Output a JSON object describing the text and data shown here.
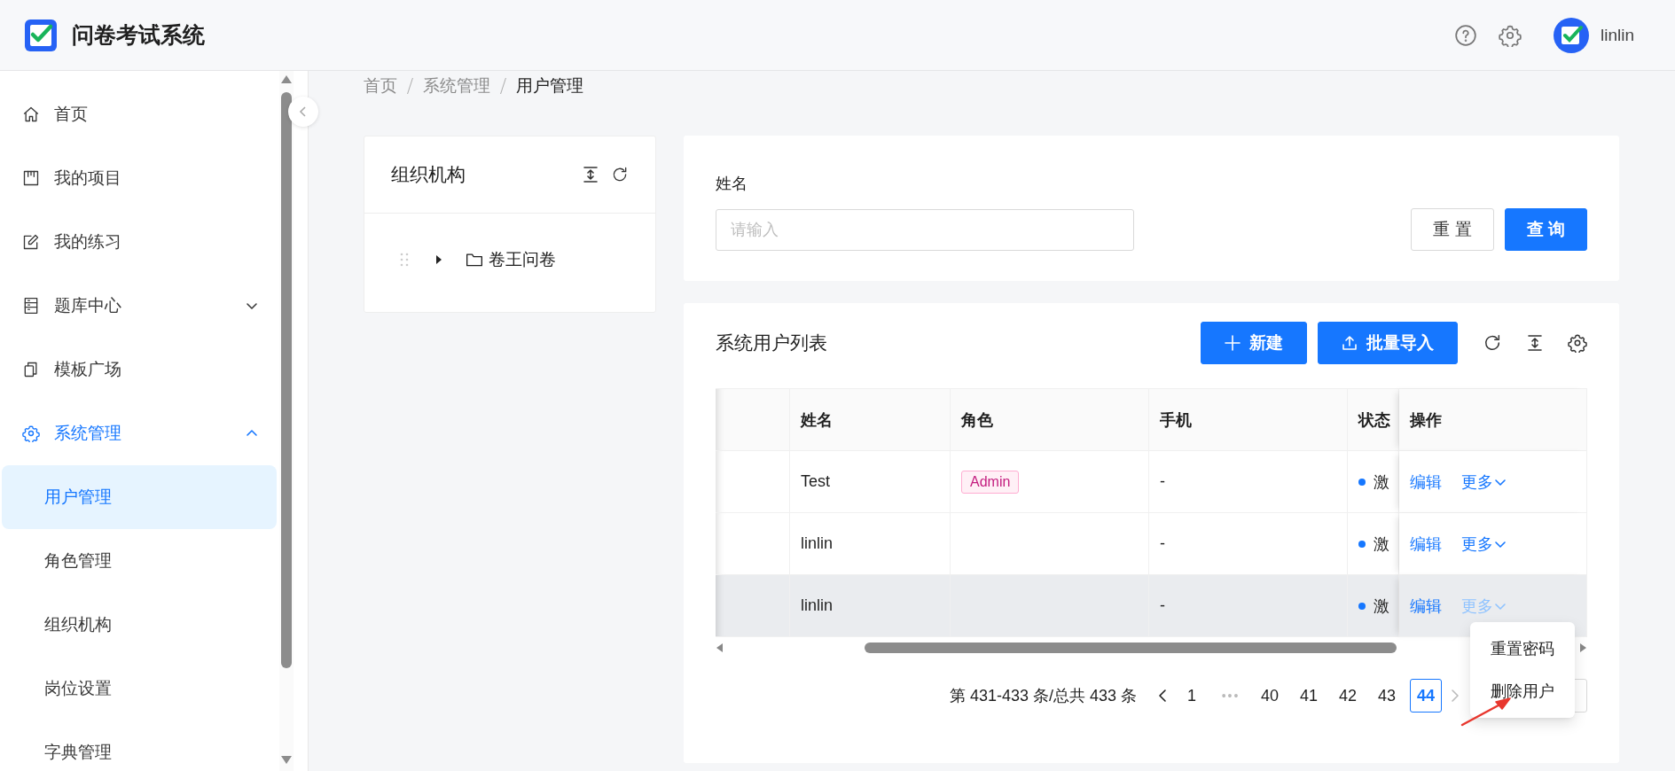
{
  "header": {
    "title": "问卷考试系统",
    "user": "linlin"
  },
  "sidebar": {
    "items": [
      {
        "label": "首页",
        "selected": false
      },
      {
        "label": "我的项目",
        "selected": false
      },
      {
        "label": "我的练习",
        "selected": false
      },
      {
        "label": "题库中心",
        "selected": false,
        "expanded": false
      },
      {
        "label": "模板广场",
        "selected": false
      },
      {
        "label": "系统管理",
        "selected": true,
        "expanded": true,
        "children": [
          {
            "label": "用户管理",
            "selected": true
          },
          {
            "label": "角色管理",
            "selected": false
          },
          {
            "label": "组织机构",
            "selected": false
          },
          {
            "label": "岗位设置",
            "selected": false
          },
          {
            "label": "字典管理",
            "selected": false
          }
        ]
      }
    ]
  },
  "breadcrumb": [
    "首页",
    "系统管理",
    "用户管理"
  ],
  "org_panel": {
    "title": "组织机构",
    "tree": [
      {
        "label": "卷王问卷",
        "expanded": false
      }
    ]
  },
  "search": {
    "label": "姓名",
    "placeholder": "请输入",
    "buttons": [
      {
        "label": "重 置",
        "kind": "default"
      },
      {
        "label": "查 询",
        "kind": "primary"
      }
    ]
  },
  "table": {
    "title": "系统用户列表",
    "actions": [
      {
        "label": "新建",
        "kind": "add"
      },
      {
        "label": "批量导入",
        "kind": "upload"
      }
    ],
    "columns": [
      "姓名",
      "角色",
      "手机",
      "状态",
      "操作"
    ],
    "rows": [
      {
        "name": "Test",
        "role": "Admin",
        "phone": "-",
        "status": "激",
        "actions": [
          "编辑",
          "更多"
        ],
        "hovered": false
      },
      {
        "name": "linlin",
        "phone": "-",
        "status": "激",
        "actions": [
          "编辑",
          "更多"
        ],
        "hovered": false
      },
      {
        "name": "linlin",
        "phone": "-",
        "status": "激",
        "actions": [
          "编辑",
          "更多"
        ],
        "hovered": true
      }
    ]
  },
  "pagination": {
    "summary": "第 431-433 条/总共 433 条",
    "pages": [
      {
        "label": "1",
        "kind": "page",
        "selected": false
      },
      {
        "label": "•••",
        "kind": "ellipsis",
        "selected": false
      },
      {
        "label": "40",
        "kind": "page",
        "selected": false
      },
      {
        "label": "41",
        "kind": "page",
        "selected": false
      },
      {
        "label": "42",
        "kind": "page",
        "selected": false
      },
      {
        "label": "43",
        "kind": "page",
        "selected": false
      },
      {
        "label": "44",
        "kind": "page",
        "selected": true
      }
    ]
  },
  "dropdown": {
    "items": [
      "重置密码",
      "删除用户"
    ]
  }
}
